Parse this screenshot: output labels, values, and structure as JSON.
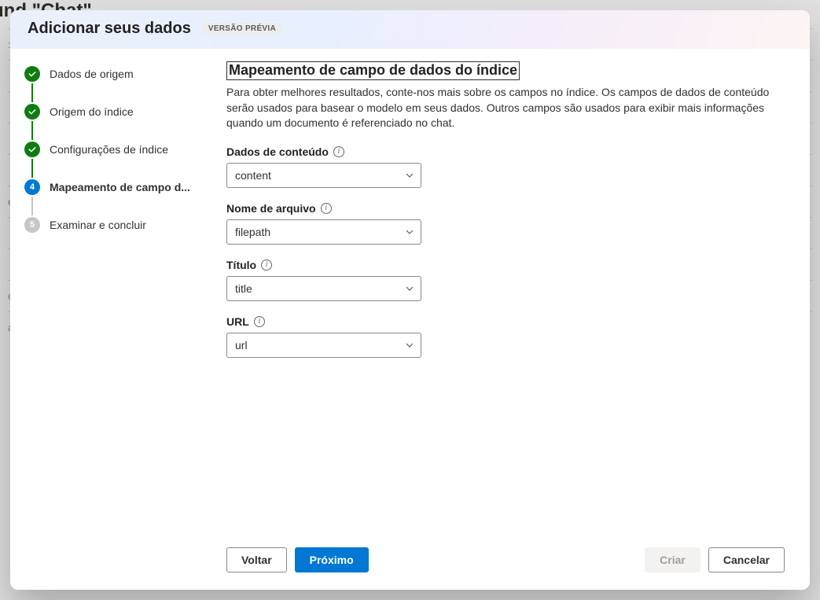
{
  "bg": {
    "title": "und \"Chat\""
  },
  "dialog": {
    "title": "Adicionar seus dados",
    "badge": "VERSÃO PRÉVIA"
  },
  "steps": [
    {
      "label": "Dados de origem",
      "state": "done"
    },
    {
      "label": "Origem do índice",
      "state": "done"
    },
    {
      "label": "Configurações de índice",
      "state": "done"
    },
    {
      "label": "Mapeamento de campo d...",
      "state": "current",
      "num": "4"
    },
    {
      "label": "Examinar e concluir",
      "state": "pending",
      "num": "5"
    }
  ],
  "content": {
    "heading": "Mapeamento de campo de dados do índice",
    "desc": "Para obter melhores resultados, conte-nos mais sobre os campos no índice. Os campos de dados de conteúdo serão usados para basear o modelo em seus dados. Outros campos são usados para exibir mais informações quando um documento é referenciado no chat."
  },
  "fields": {
    "content": {
      "label": "Dados de conteúdo",
      "value": "content"
    },
    "filename": {
      "label": "Nome de arquivo",
      "value": "filepath"
    },
    "title": {
      "label": "Título",
      "value": "title"
    },
    "url": {
      "label": "URL",
      "value": "url"
    }
  },
  "footer": {
    "back": "Voltar",
    "next": "Próximo",
    "create": "Criar",
    "cancel": "Cancelar"
  }
}
